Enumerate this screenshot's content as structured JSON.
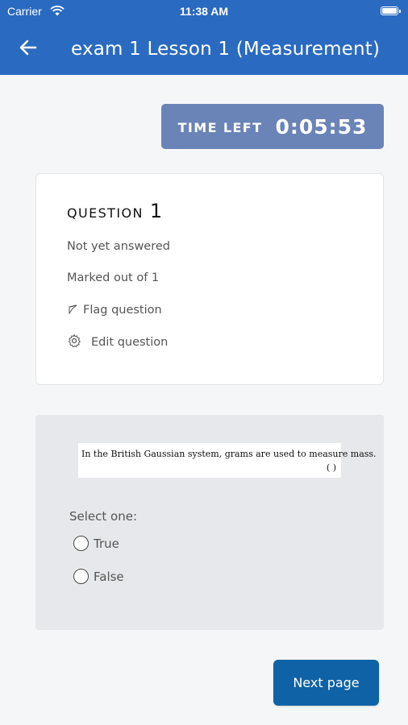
{
  "status_bar": {
    "carrier": "Carrier",
    "time": "11:38 AM"
  },
  "header": {
    "title": "exam 1 Lesson 1 (Measurement)",
    "back_icon": "arrow-left-icon"
  },
  "timer": {
    "label": "TIME LEFT",
    "value": "0:05:53"
  },
  "question": {
    "label": "QUESTION",
    "number": "1",
    "state": "Not yet answered",
    "marks": "Marked out of 1",
    "flag_label": "Flag question",
    "edit_label": "Edit question"
  },
  "answer": {
    "question_text": "In the British Gaussian system, grams are used to measure mass.",
    "question_paren": "(      )",
    "select_label": "Select one:",
    "options": [
      {
        "label": "True"
      },
      {
        "label": "False"
      }
    ]
  },
  "footer": {
    "next_label": "Next page"
  },
  "colors": {
    "header": "#2a6ac1",
    "timer": "#6b84b7",
    "next_button": "#0f62a6"
  }
}
